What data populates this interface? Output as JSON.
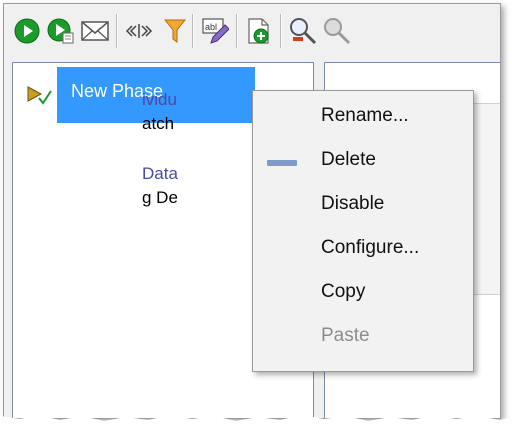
{
  "toolbar": {
    "buttons": [
      {
        "name": "run-icon",
        "color": "#1a9b2a"
      },
      {
        "name": "run-step-icon",
        "color": "#1a9b2a"
      },
      {
        "name": "envelope-icon",
        "color": "#555555"
      },
      {
        "name": "split-icon",
        "color": "#555555"
      },
      {
        "name": "filter-icon",
        "color": "#e8a020"
      },
      {
        "name": "edit-text-icon",
        "color": "#6a4aa0"
      },
      {
        "name": "add-document-icon",
        "color": "#1a9b2a"
      },
      {
        "name": "find-icon",
        "color": "#d04020"
      },
      {
        "name": "find-disabled-icon",
        "color": "#9a9a9a"
      }
    ]
  },
  "tree": {
    "items": [
      {
        "label": "New Phase",
        "icon": "phase-enabled-icon",
        "selected": true
      }
    ]
  },
  "details": {
    "line1_link": "ividu",
    "line1_text": "atch",
    "line2_link": "Data",
    "line2_text": "g De"
  },
  "context_menu": {
    "items": [
      {
        "label": "Rename...",
        "enabled": true
      },
      {
        "label": "Delete",
        "enabled": true,
        "icon": "delete-dash-icon"
      },
      {
        "label": "Disable",
        "enabled": true
      },
      {
        "label": "Configure...",
        "enabled": true
      },
      {
        "label": "Copy",
        "enabled": true
      },
      {
        "label": "Paste",
        "enabled": false
      }
    ]
  },
  "colors": {
    "selection": "#3399ff",
    "menu_background": "#f2f2f2",
    "disabled_text": "#8c8c8c"
  }
}
